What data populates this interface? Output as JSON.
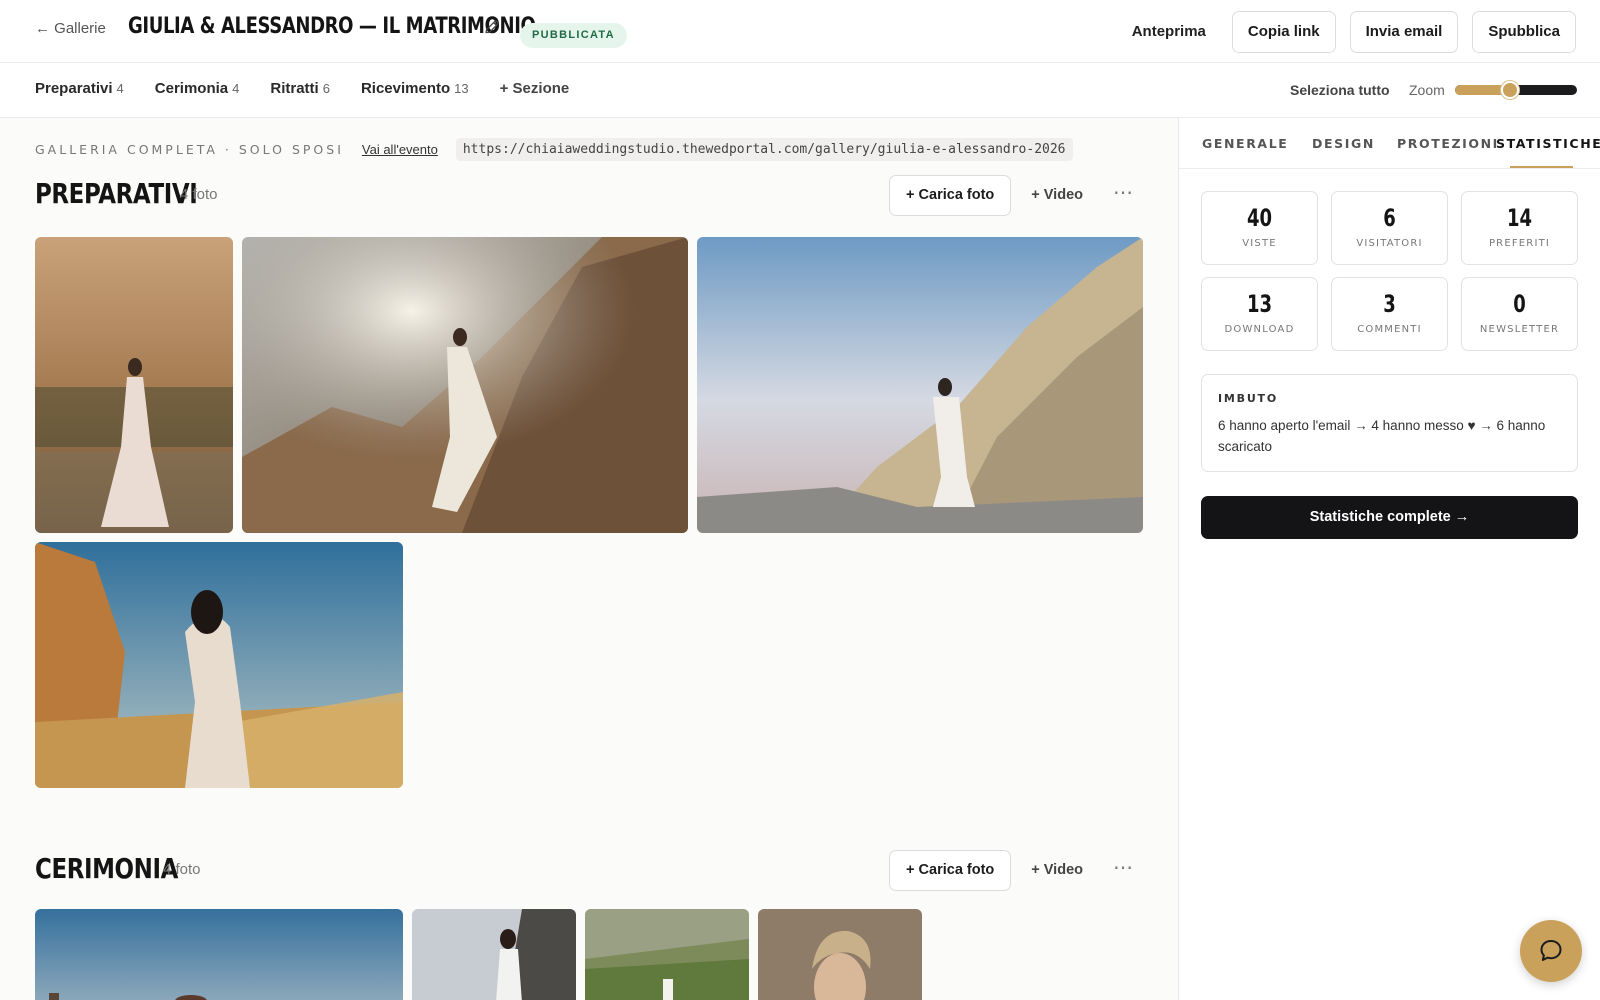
{
  "header": {
    "back_label": "← Gallerie",
    "title": "GIULIA & ALESSANDRO — IL MATRIMONIO",
    "status": "PUBBLICATA",
    "actions": [
      "Anteprima",
      "Copia link",
      "Invia email",
      "Spubblica"
    ]
  },
  "sections_nav": {
    "items": [
      {
        "label": "Preparativi",
        "count": "4"
      },
      {
        "label": "Cerimonia",
        "count": "4"
      },
      {
        "label": "Ritratti",
        "count": "6"
      },
      {
        "label": "Ricevimento",
        "count": "13"
      }
    ],
    "add_label": "+ Sezione",
    "select_all": "Seleziona tutto",
    "zoom_label": "Zoom",
    "zoom_value": 0.45
  },
  "meta": {
    "label": "GALLERIA COMPLETA · SOLO SPOSI",
    "event_link": "Vai all'evento",
    "url": "https://chiaiaweddingstudio.thewedportal.com/gallery/giulia-e-alessandro-2026"
  },
  "gallery_sections": [
    {
      "title": "PREPARATIVI",
      "count_label": "4 foto",
      "upload": "+ Carica foto",
      "video": "+ Video",
      "more": "⋯"
    },
    {
      "title": "CERIMONIA",
      "count_label": "4 foto",
      "upload": "+ Carica foto",
      "video": "+ Video",
      "more": "⋯"
    }
  ],
  "panel": {
    "tabs": [
      "GENERALE",
      "DESIGN",
      "PROTEZIONI",
      "STATISTICHE"
    ],
    "active_tab": "STATISTICHE",
    "stats": [
      {
        "value": "40",
        "label": "VISTE"
      },
      {
        "value": "6",
        "label": "VISITATORI"
      },
      {
        "value": "14",
        "label": "PREFERITI"
      },
      {
        "value": "13",
        "label": "DOWNLOAD"
      },
      {
        "value": "3",
        "label": "COMMENTI"
      },
      {
        "value": "0",
        "label": "NEWSLETTER"
      }
    ],
    "funnel_title": "IMBUTO",
    "funnel_text": "6 hanno aperto l'email → 4 hanno messo ♥ → 6 hanno scaricato",
    "full_stats_button": "Statistiche complete →"
  },
  "colors": {
    "accent": "#c9a15b",
    "badge_bg": "#e6f5ec",
    "badge_text": "#1f6b45",
    "dark": "#141416"
  },
  "icons": [
    "arrow-left-icon",
    "pencil-icon",
    "chat-icon"
  ]
}
